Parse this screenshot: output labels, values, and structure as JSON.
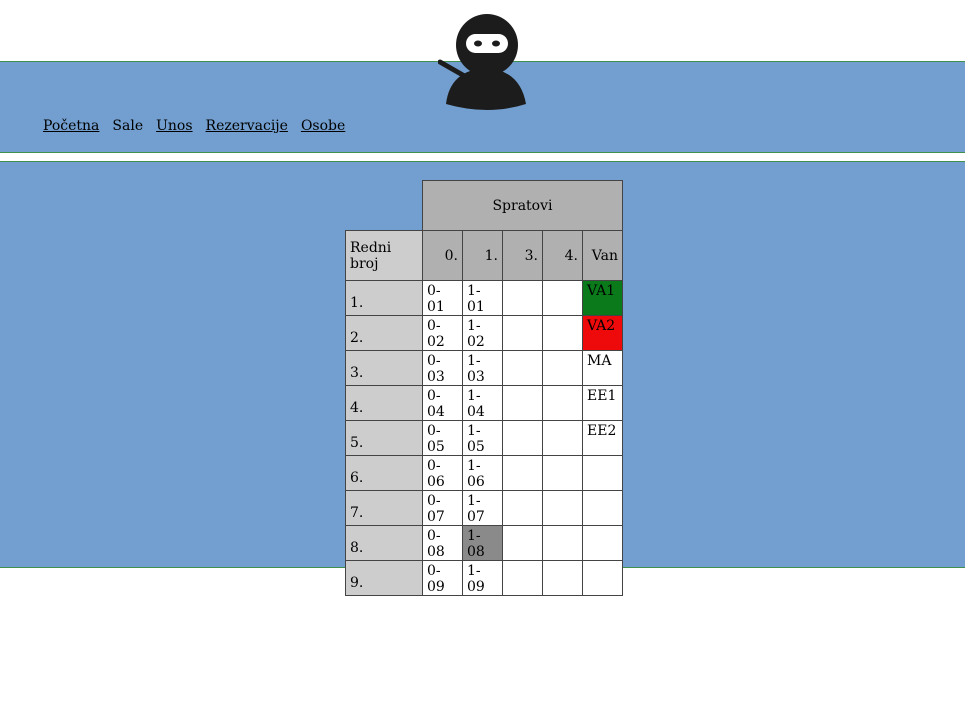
{
  "nav": {
    "items": [
      "Početna",
      "Sale",
      "Unos",
      "Rezervacije",
      "Osobe"
    ]
  },
  "colors": {
    "band": "#729fcf",
    "border": "#3f8f4f",
    "occupied_green": "#0a7a1a",
    "occupied_red": "#ee0a0a",
    "selected_gray": "#8a8a8a"
  },
  "table": {
    "group_header": "Spratovi",
    "row_header": "Redni broj",
    "columns": [
      "0.",
      "1.",
      "3.",
      "4.",
      "Van"
    ],
    "rows": [
      {
        "num": "1.",
        "cells": [
          "0-01",
          "1-01",
          "",
          "",
          "VA1"
        ]
      },
      {
        "num": "2.",
        "cells": [
          "0-02",
          "1-02",
          "",
          "",
          "VA2"
        ]
      },
      {
        "num": "3.",
        "cells": [
          "0-03",
          "1-03",
          "",
          "",
          "MA"
        ]
      },
      {
        "num": "4.",
        "cells": [
          "0-04",
          "1-04",
          "",
          "",
          "EE1"
        ]
      },
      {
        "num": "5.",
        "cells": [
          "0-05",
          "1-05",
          "",
          "",
          "EE2"
        ]
      },
      {
        "num": "6.",
        "cells": [
          "0-06",
          "1-06",
          "",
          "",
          ""
        ]
      },
      {
        "num": "7.",
        "cells": [
          "0-07",
          "1-07",
          "",
          "",
          ""
        ]
      },
      {
        "num": "8.",
        "cells": [
          "0-08",
          "1-08",
          "",
          "",
          ""
        ]
      },
      {
        "num": "9.",
        "cells": [
          "0-09",
          "1-09",
          "",
          "",
          ""
        ]
      }
    ]
  }
}
